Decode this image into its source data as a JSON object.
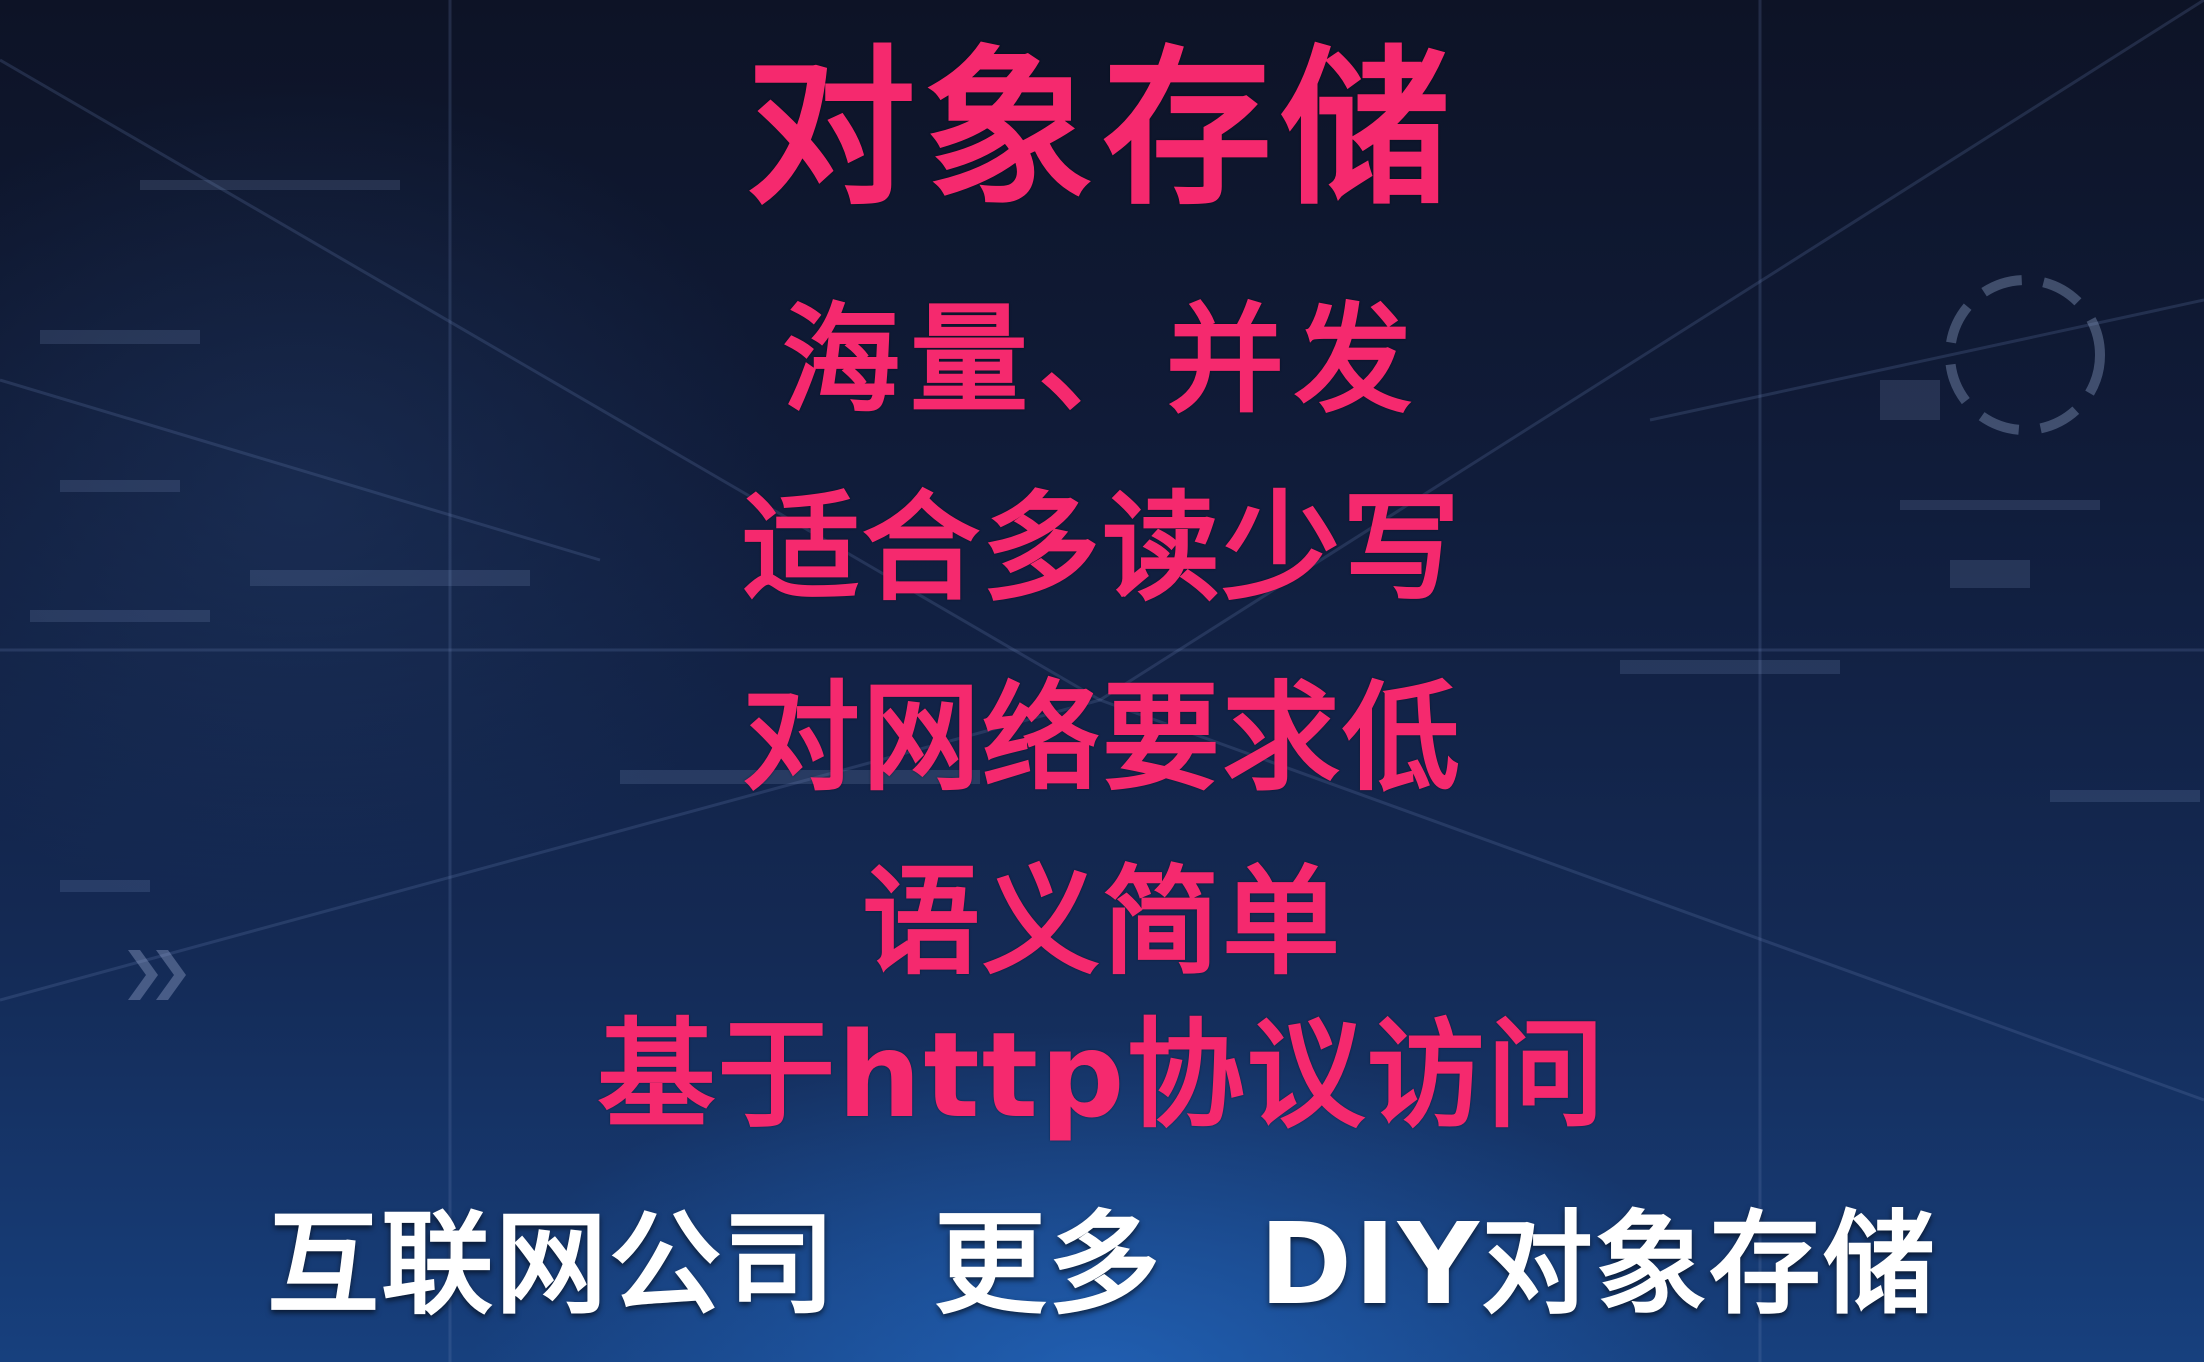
{
  "title": "对象存储",
  "features": [
    "海量、并发",
    "适合多读少写",
    "对网络要求低",
    "语义简单",
    "基于http协议访问"
  ],
  "footer": {
    "part1": "互联网公司",
    "part2": "更多",
    "part3": "DIY对象存储"
  },
  "colors": {
    "headline": "#f5296e",
    "footer": "#ffffff",
    "background": "#101c3a"
  }
}
